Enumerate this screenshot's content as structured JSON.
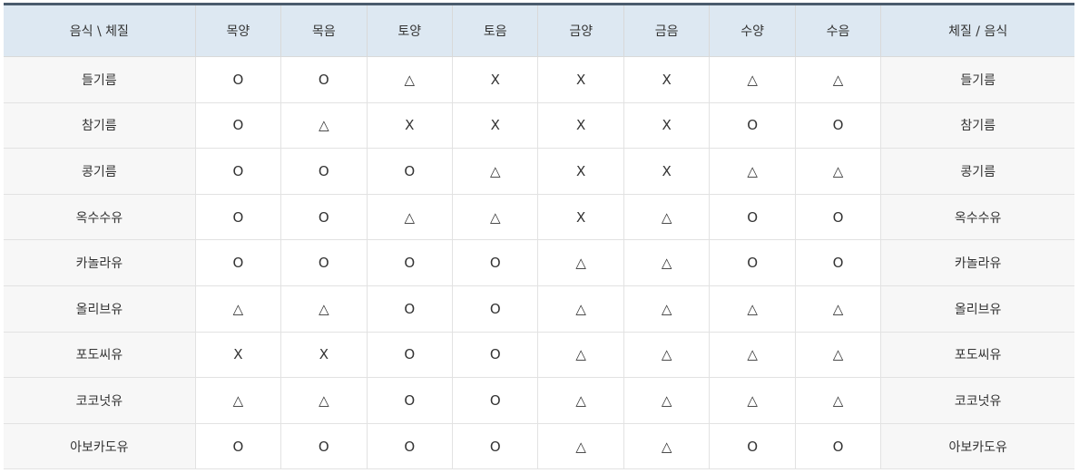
{
  "table": {
    "headers": [
      "음식 \\ 체질",
      "목양",
      "목음",
      "토양",
      "토음",
      "금양",
      "금음",
      "수양",
      "수음",
      "체질 / 음식"
    ],
    "rows": [
      {
        "food": "들기름",
        "marks": [
          "O",
          "O",
          "△",
          "X",
          "X",
          "X",
          "△",
          "△"
        ]
      },
      {
        "food": "참기름",
        "marks": [
          "O",
          "△",
          "X",
          "X",
          "X",
          "X",
          "O",
          "O"
        ]
      },
      {
        "food": "콩기름",
        "marks": [
          "O",
          "O",
          "O",
          "△",
          "X",
          "X",
          "△",
          "△"
        ]
      },
      {
        "food": "옥수수유",
        "marks": [
          "O",
          "O",
          "△",
          "△",
          "X",
          "△",
          "O",
          "O"
        ]
      },
      {
        "food": "카놀라유",
        "marks": [
          "O",
          "O",
          "O",
          "O",
          "△",
          "△",
          "O",
          "O"
        ]
      },
      {
        "food": "올리브유",
        "marks": [
          "△",
          "△",
          "O",
          "O",
          "△",
          "△",
          "△",
          "△"
        ]
      },
      {
        "food": "포도씨유",
        "marks": [
          "X",
          "X",
          "O",
          "O",
          "△",
          "△",
          "△",
          "△"
        ]
      },
      {
        "food": "코코넛유",
        "marks": [
          "△",
          "△",
          "O",
          "O",
          "△",
          "△",
          "△",
          "△"
        ]
      },
      {
        "food": "아보카도유",
        "marks": [
          "O",
          "O",
          "O",
          "O",
          "△",
          "△",
          "O",
          "O"
        ]
      }
    ]
  },
  "colors": {
    "header_bg": "#dde8f2",
    "top_border": "#4a5b6d",
    "food_cell_bg": "#f7f7f7",
    "grid_line": "#e2e2e2",
    "text": "#333333"
  }
}
